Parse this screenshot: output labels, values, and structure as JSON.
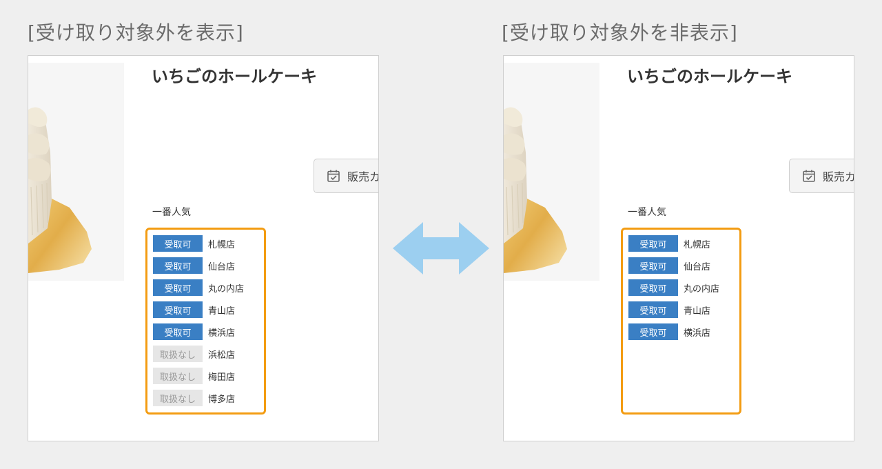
{
  "left_panel": {
    "heading": "[受け取り対象外を表示]",
    "product_title": "いちごのホールケーキ",
    "calendar_button_label": "販売カレンダー",
    "popular_label": "一番人気",
    "stores": [
      {
        "status": "受取可",
        "name": "札幌店",
        "available": true
      },
      {
        "status": "受取可",
        "name": "仙台店",
        "available": true
      },
      {
        "status": "受取可",
        "name": "丸の内店",
        "available": true
      },
      {
        "status": "受取可",
        "name": "青山店",
        "available": true
      },
      {
        "status": "受取可",
        "name": "横浜店",
        "available": true
      },
      {
        "status": "取扱なし",
        "name": "浜松店",
        "available": false
      },
      {
        "status": "取扱なし",
        "name": "梅田店",
        "available": false
      },
      {
        "status": "取扱なし",
        "name": "博多店",
        "available": false
      }
    ]
  },
  "right_panel": {
    "heading": "[受け取り対象外を非表示]",
    "product_title": "いちごのホールケーキ",
    "calendar_button_label": "販売カレンダー",
    "popular_label": "一番人気",
    "stores": [
      {
        "status": "受取可",
        "name": "札幌店",
        "available": true
      },
      {
        "status": "受取可",
        "name": "仙台店",
        "available": true
      },
      {
        "status": "受取可",
        "name": "丸の内店",
        "available": true
      },
      {
        "status": "受取可",
        "name": "青山店",
        "available": true
      },
      {
        "status": "受取可",
        "name": "横浜店",
        "available": true
      }
    ]
  },
  "colors": {
    "available_badge": "#3a7fc4",
    "unavailable_badge": "#e6e6e6",
    "highlight_border": "#f39c12",
    "arrow": "#9ccff0"
  },
  "icons": {
    "calendar": "calendar-check-icon",
    "arrow": "double-arrow-icon"
  }
}
